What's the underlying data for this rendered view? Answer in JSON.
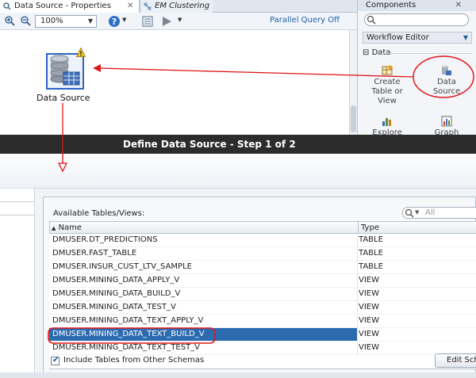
{
  "editor": {
    "tabs": [
      {
        "label": "Data Source - Properties",
        "active": true
      },
      {
        "label": "EM Clustering",
        "active": false
      }
    ],
    "zoom_value": "100%",
    "parallel_query": "Parallel Query Off",
    "node_label": "Data Source"
  },
  "components": {
    "title": "Components",
    "search_placeholder": "",
    "workflow_select": "Workflow Editor",
    "section": "Data",
    "items": [
      {
        "label": "Create Table or View",
        "icon": "create-table-icon"
      },
      {
        "label": "Data Source",
        "icon": "data-source-icon"
      },
      {
        "label": "Explore",
        "icon": "explore-icon"
      },
      {
        "label": "Graph",
        "icon": "graph-icon"
      }
    ]
  },
  "dialog": {
    "title": "Define Data Source - Step 1 of 2",
    "available_label": "Available Tables/Views:",
    "search_placeholder": "All",
    "columns": {
      "name": "Name",
      "type": "Type"
    },
    "rows": [
      {
        "name": "DMUSER.DT_PREDICTIONS",
        "type": "TABLE"
      },
      {
        "name": "DMUSER.FAST_TABLE",
        "type": "TABLE"
      },
      {
        "name": "DMUSER.INSUR_CUST_LTV_SAMPLE",
        "type": "TABLE"
      },
      {
        "name": "DMUSER.MINING_DATA_APPLY_V",
        "type": "VIEW"
      },
      {
        "name": "DMUSER.MINING_DATA_BUILD_V",
        "type": "VIEW"
      },
      {
        "name": "DMUSER.MINING_DATA_TEST_V",
        "type": "VIEW"
      },
      {
        "name": "DMUSER.MINING_DATA_TEXT_APPLY_V",
        "type": "VIEW"
      },
      {
        "name": "DMUSER.MINING_DATA_TEXT_BUILD_V",
        "type": "VIEW",
        "selected": true
      },
      {
        "name": "DMUSER.MINING_DATA_TEXT_TEST_V",
        "type": "VIEW"
      }
    ],
    "include_checkbox_label": "Include Tables from Other Schemas",
    "include_checked": true,
    "edit_button": "Edit Sche"
  },
  "colors": {
    "selection": "#2d6bb0",
    "annotation": "#e0181b",
    "title_bar": "#2c2c2c"
  }
}
